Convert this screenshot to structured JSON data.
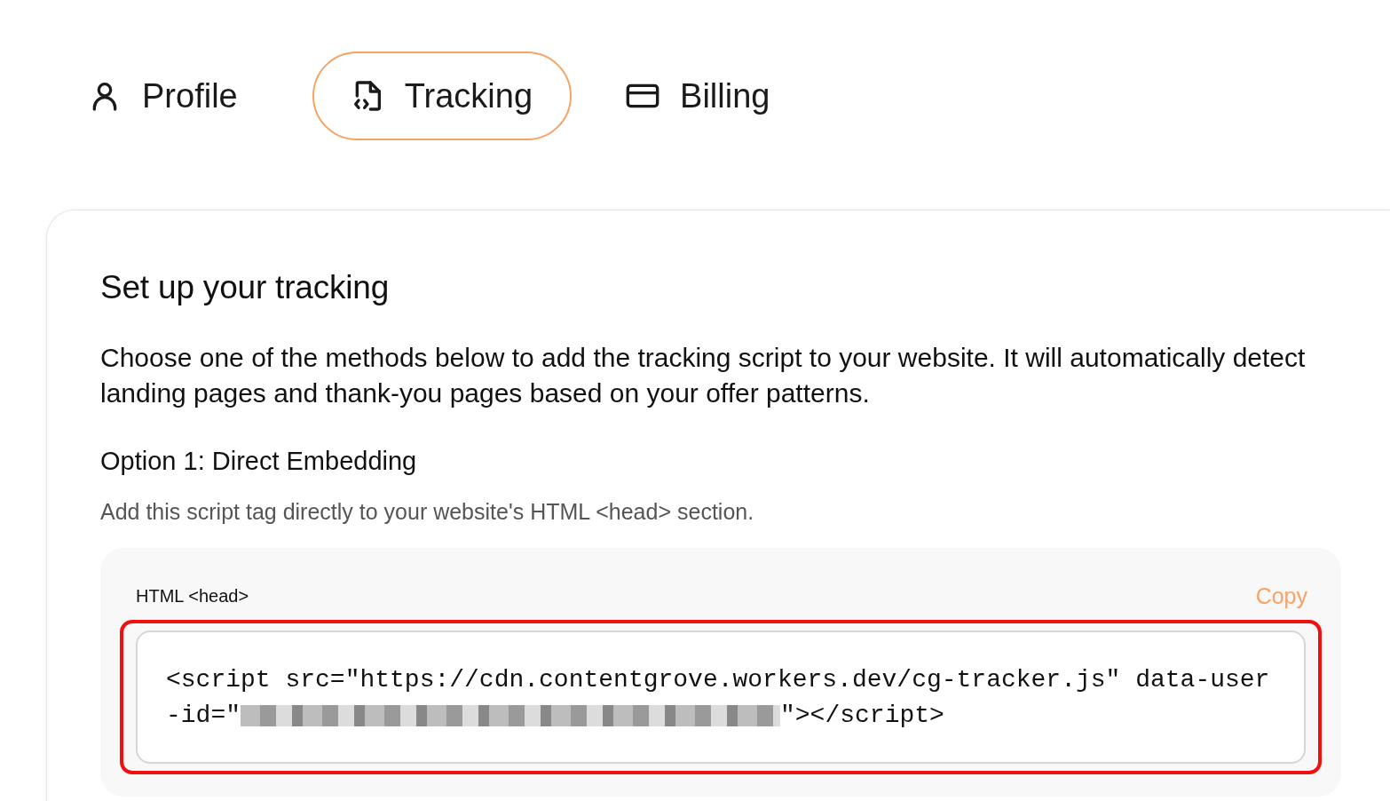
{
  "tabs": [
    {
      "label": "Profile",
      "kind": "person",
      "selected": false
    },
    {
      "label": "Tracking",
      "kind": "code-file",
      "selected": true
    },
    {
      "label": "Billing",
      "kind": "card",
      "selected": false
    }
  ],
  "card": {
    "title": "Set up your tracking",
    "description": "Choose one of the methods below to add the tracking script to your website. It will automatically detect landing pages and thank-you pages based on your offer patterns.",
    "option": {
      "title": "Option 1: Direct Embedding",
      "hint": "Add this script tag directly to your website's HTML <head> section.",
      "code_panel": {
        "label": "HTML <head>",
        "copy": "Copy",
        "highlighted": true,
        "code": {
          "line_1": "<script src=\"https://cdn.contentgrove.workers.dev/cg-tracker.js\" data-user",
          "line_2_start": "-id=\"",
          "redacted": true,
          "line_2_end": "\"></script>"
        }
      }
    }
  }
}
